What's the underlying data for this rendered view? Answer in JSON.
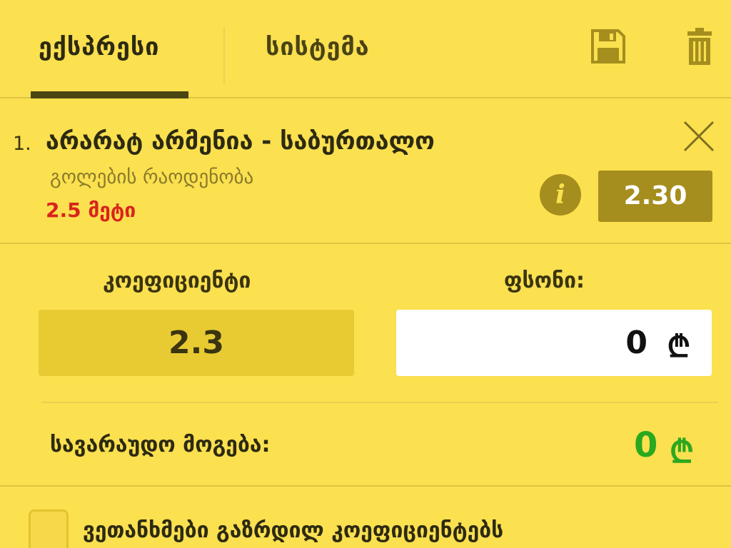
{
  "tabs": {
    "express_label": "ექსპრესი",
    "system_label": "სისტემა",
    "save_icon": "save-icon",
    "trash_icon": "trash-icon"
  },
  "bet": {
    "index": "1.",
    "title": "არარატ არმენია - საბურთალო",
    "market": "გოლების რაოდენობა",
    "selection": "2.5 მეტი",
    "odd": "2.30",
    "info_icon": "i"
  },
  "coefficient": {
    "label": "კოეფიციენტი",
    "value": "2.3"
  },
  "stake": {
    "label": "ფსონი:",
    "value": "0",
    "currency": "₾"
  },
  "possible_win": {
    "label": "სავარაუდო მოგება:",
    "value": "0",
    "currency": "₾"
  },
  "accept_odds": {
    "label": "ვეთანხმები გაზრდილ კოეფიციენტებს",
    "checked": false
  },
  "colors": {
    "background": "#fbe04f",
    "accent_dark": "#a58e1e",
    "win_green": "#2aa81f",
    "selection_red": "#d9231d"
  }
}
